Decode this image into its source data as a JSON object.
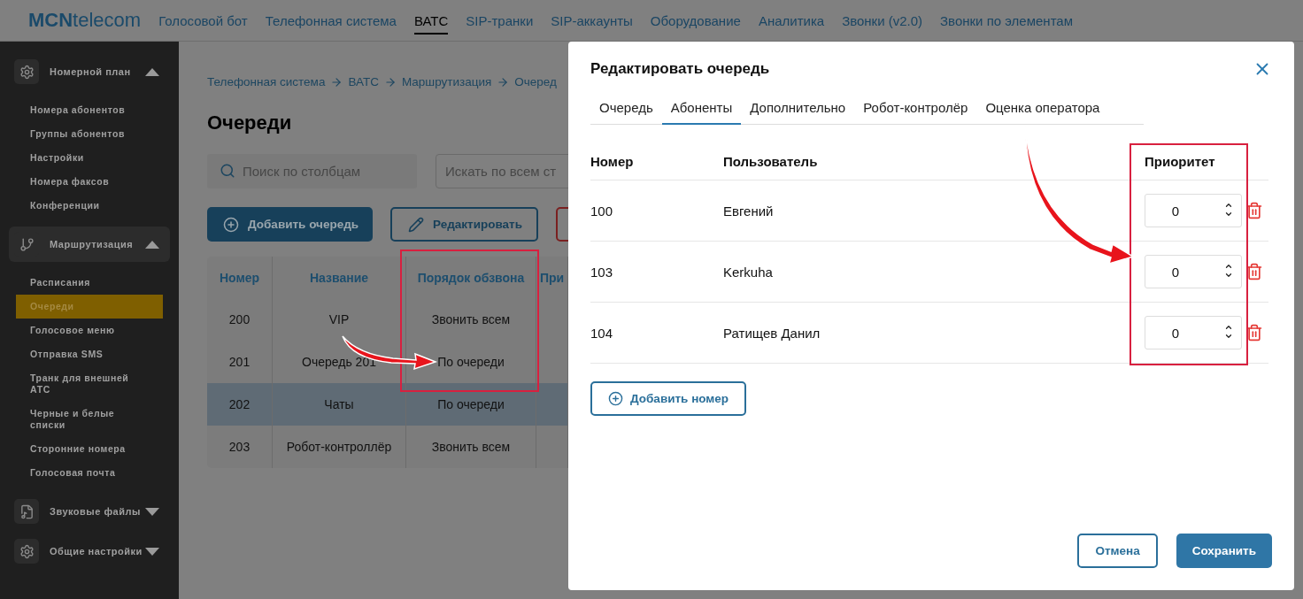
{
  "topbar": {
    "logo": {
      "bold": "MCN",
      "light": "telecom"
    },
    "nav": [
      {
        "label": "Голосовой бот",
        "selected": false
      },
      {
        "label": "Телефонная система",
        "selected": false
      },
      {
        "label": "ВАТС",
        "selected": true
      },
      {
        "label": "SIP-транки",
        "selected": false
      },
      {
        "label": "SIP-аккаунты",
        "selected": false
      },
      {
        "label": "Оборудование",
        "selected": false
      },
      {
        "label": "Аналитика",
        "selected": false
      },
      {
        "label": "Звонки (v2.0)",
        "selected": false
      },
      {
        "label": "Звонки по элементам",
        "selected": false
      }
    ]
  },
  "sidebar": {
    "sections": [
      {
        "label": "Номерной план",
        "expanded": true,
        "items": [
          {
            "label": "Номера абонентов",
            "selected": false
          },
          {
            "label": "Группы абонентов",
            "selected": false
          },
          {
            "label": "Настройки",
            "selected": false
          },
          {
            "label": "Номера факсов",
            "selected": false
          },
          {
            "label": "Конференции",
            "selected": false
          }
        ]
      },
      {
        "label": "Маршрутизация",
        "expanded": true,
        "items": [
          {
            "label": "Расписания",
            "selected": false
          },
          {
            "label": "Очереди",
            "selected": true
          },
          {
            "label": "Голосовое меню",
            "selected": false
          },
          {
            "label": "Отправка SMS",
            "selected": false
          },
          {
            "label": "Транк для внешней АТС",
            "selected": false
          },
          {
            "label": "Черные и белые списки",
            "selected": false
          },
          {
            "label": "Сторонние номера",
            "selected": false
          },
          {
            "label": "Голосовая почта",
            "selected": false
          }
        ]
      },
      {
        "label": "Звуковые файлы",
        "expanded": false
      },
      {
        "label": "Общие настройки",
        "expanded": false
      }
    ]
  },
  "page": {
    "breadcrumb": [
      "Телефонная система",
      "ВАТС",
      "Маршрутизация",
      "Очеред"
    ],
    "title": "Очереди",
    "search": {
      "placeholder": "Поиск по столбцам"
    },
    "search_all": {
      "placeholder": "Искать по всем ст"
    },
    "buttons": [
      {
        "label": "Добавить очередь",
        "kind": "primary"
      },
      {
        "label": "Редактировать",
        "kind": "edit"
      },
      {
        "kind": "danger"
      }
    ],
    "table": {
      "columns": [
        "Номер",
        "Название",
        "Порядок обзвона",
        "При"
      ],
      "rows": [
        {
          "cells": [
            "200",
            "VIP",
            "Звонить всем"
          ],
          "selected": false
        },
        {
          "cells": [
            "201",
            "Очередь 201",
            "По очереди"
          ],
          "selected": false
        },
        {
          "cells": [
            "202",
            "Чаты",
            "По очереди"
          ],
          "selected": true
        },
        {
          "cells": [
            "203",
            "Робот-контроллёр",
            "Звонить всем"
          ],
          "selected": false
        }
      ]
    }
  },
  "dialog": {
    "title": "Редактировать очередь",
    "tabs": [
      {
        "label": "Очередь",
        "selected": false
      },
      {
        "label": "Абоненты",
        "selected": true
      },
      {
        "label": "Дополнительно",
        "selected": false
      },
      {
        "label": "Робот-контролёр",
        "selected": false
      },
      {
        "label": "Оценка оператора",
        "selected": false
      }
    ],
    "columns": [
      "Номер",
      "Пользователь",
      "Приоритет"
    ],
    "rows": [
      {
        "number": "100",
        "user": "Евгений",
        "priority": "0"
      },
      {
        "number": "103",
        "user": "Kerkuha",
        "priority": "0"
      },
      {
        "number": "104",
        "user": "Ратищев Данил",
        "priority": "0"
      }
    ],
    "add_button": "Добавить номер",
    "cancel_button": "Отмена",
    "save_button": "Сохранить"
  }
}
